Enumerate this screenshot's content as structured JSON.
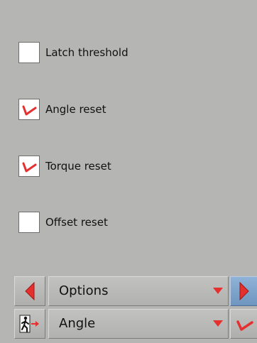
{
  "options": [
    {
      "label": "Latch threshold",
      "checked": false
    },
    {
      "label": "Angle reset",
      "checked": true
    },
    {
      "label": "Torque reset",
      "checked": true
    },
    {
      "label": "Offset reset",
      "checked": false
    }
  ],
  "nav": {
    "menu_select": "Options",
    "mode_select": "Angle"
  },
  "icons": {
    "prev": "left-arrow-icon",
    "next": "right-arrow-icon",
    "exit": "exit-person-icon",
    "confirm": "checkmark-icon",
    "dropdown": "triangle-down-icon"
  },
  "colors": {
    "accent_red": "#e53030",
    "background": "#b5b6b3",
    "highlight_blue": "#7ea3cc"
  }
}
